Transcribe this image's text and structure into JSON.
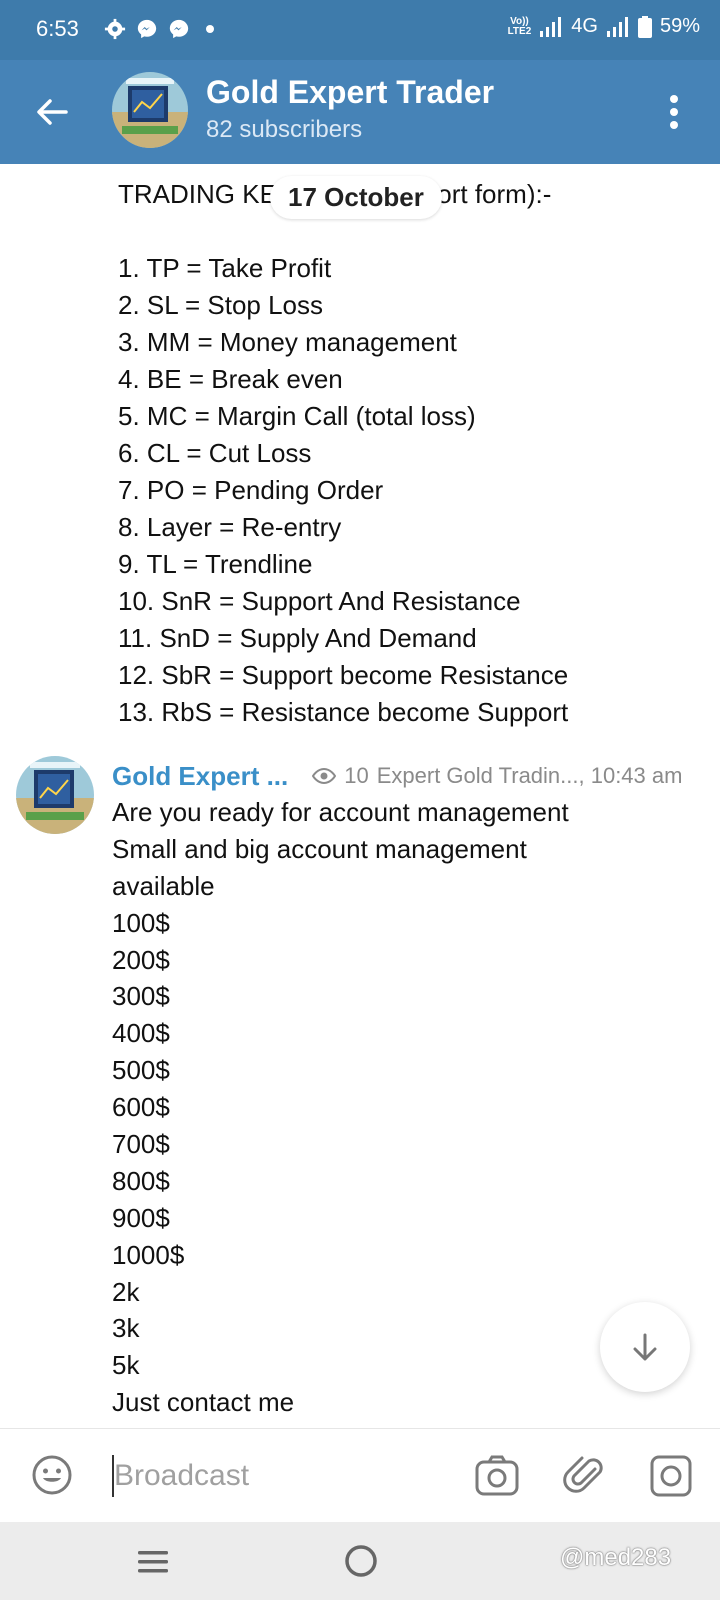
{
  "status_bar": {
    "time": "6:53",
    "network_type": "4G",
    "volte_label": "Vo))\nLTE2",
    "battery": "59%"
  },
  "header": {
    "title": "Gold Expert Trader",
    "subtitle": "82 subscribers",
    "accent_color": "#4683b7"
  },
  "date_separator": "17 October",
  "message1": {
    "lines": [
      "TRADING KEYWORDS (short form):-",
      "",
      "1. TP = Take Profit",
      "2. SL = Stop Loss",
      "3. MM = Money management",
      "4. BE = Break even",
      "5. MC = Margin Call (total loss)",
      "6. CL = Cut Loss",
      "7. PO = Pending Order",
      "8. Layer = Re-entry",
      "9. TL = Trendline",
      "10. SnR = Support And Resistance",
      "11. SnD = Supply And Demand",
      "12. SbR = Support become Resistance",
      "13. RbS = Resistance become Support"
    ]
  },
  "message2": {
    "author": "Gold Expert ...",
    "views": "10",
    "signature": "Expert Gold Tradin..., 10:43 am",
    "author_color": "#3a8fc8",
    "lines": [
      "Are you ready for account management",
      "Small and big account management",
      "available",
      "100$",
      "200$",
      "300$",
      "400$",
      "500$",
      "600$",
      "700$",
      "800$",
      "900$",
      "1000$",
      "2k",
      "3k",
      "5k",
      "Just contact me"
    ]
  },
  "composer": {
    "placeholder": "Broadcast"
  },
  "watermark": "@med283",
  "icons": {
    "back": "arrow-left-icon",
    "menu": "more-vert-icon",
    "emoji": "emoji-icon",
    "camera": "camera-icon",
    "attach": "paperclip-icon",
    "instant": "instant-camera-icon",
    "scroll_down": "arrow-down-icon"
  }
}
